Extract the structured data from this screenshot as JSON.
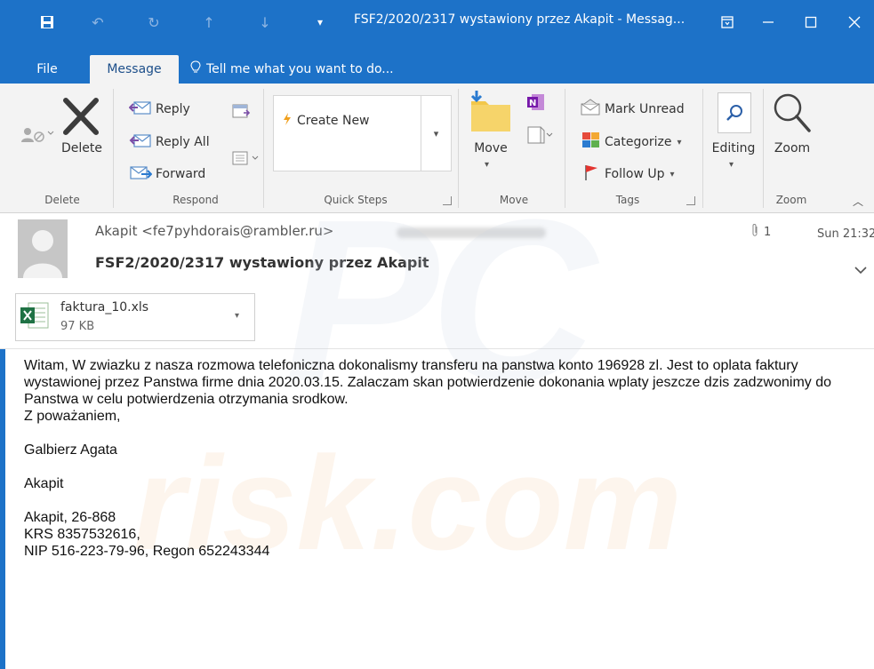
{
  "titlebar": {
    "title": "FSF2/2020/2317 wystawiony przez Akapit - Messag...",
    "icons": [
      "save-icon",
      "undo-icon",
      "redo-icon",
      "up-arrow-icon",
      "down-arrow-icon",
      "customize-qat-icon"
    ],
    "window_controls": [
      "ribbon-display-icon",
      "minimize-icon",
      "maximize-icon",
      "close-icon"
    ]
  },
  "tabs": {
    "file": "File",
    "message": "Message",
    "tell_me": "Tell me what you want to do..."
  },
  "ribbon": {
    "delete_group": {
      "delete": "Delete",
      "label": "Delete"
    },
    "respond_group": {
      "reply": "Reply",
      "reply_all": "Reply All",
      "forward": "Forward",
      "label": "Respond"
    },
    "quick_steps": {
      "create_new": "Create New",
      "label": "Quick Steps"
    },
    "move_group": {
      "move": "Move",
      "label": "Move"
    },
    "tags_group": {
      "mark_unread": "Mark Unread",
      "categorize": "Categorize",
      "follow_up": "Follow Up",
      "label": "Tags"
    },
    "editing": "Editing",
    "zoom_group": {
      "zoom": "Zoom",
      "label": "Zoom"
    }
  },
  "message": {
    "from": "Akapit <fe7pyhdorais@rambler.ru>",
    "subject": "FSF2/2020/2317 wystawiony przez Akapit",
    "attachment_count": "1",
    "time": "Sun 21:32"
  },
  "attachment": {
    "name": "faktura_10.xls",
    "size": "97 KB"
  },
  "body": {
    "paragraph1": "Witam, W zwiazku z nasza rozmowa telefoniczna dokonalismy transferu na panstwa konto 196928 zl. Jest to oplata faktury wystawionej przez Panstwa firme dnia 2020.03.15. Zalaczam skan potwierdzenie dokonania wplaty jeszcze dzis zadzwonimy do Panstwa w celu potwierdzenia otrzymania srodkow.",
    "closing": "Z poważaniem,",
    "name": "Galbierz Agata",
    "company": "Akapit",
    "address": "Akapit, 26-868",
    "krs": "KRS 8357532616,",
    "nip": "NIP 516-223-79-96, Regon 652243344"
  },
  "colors": {
    "accent": "#1d72c8",
    "ribbon_bg": "#f3f3f3"
  }
}
